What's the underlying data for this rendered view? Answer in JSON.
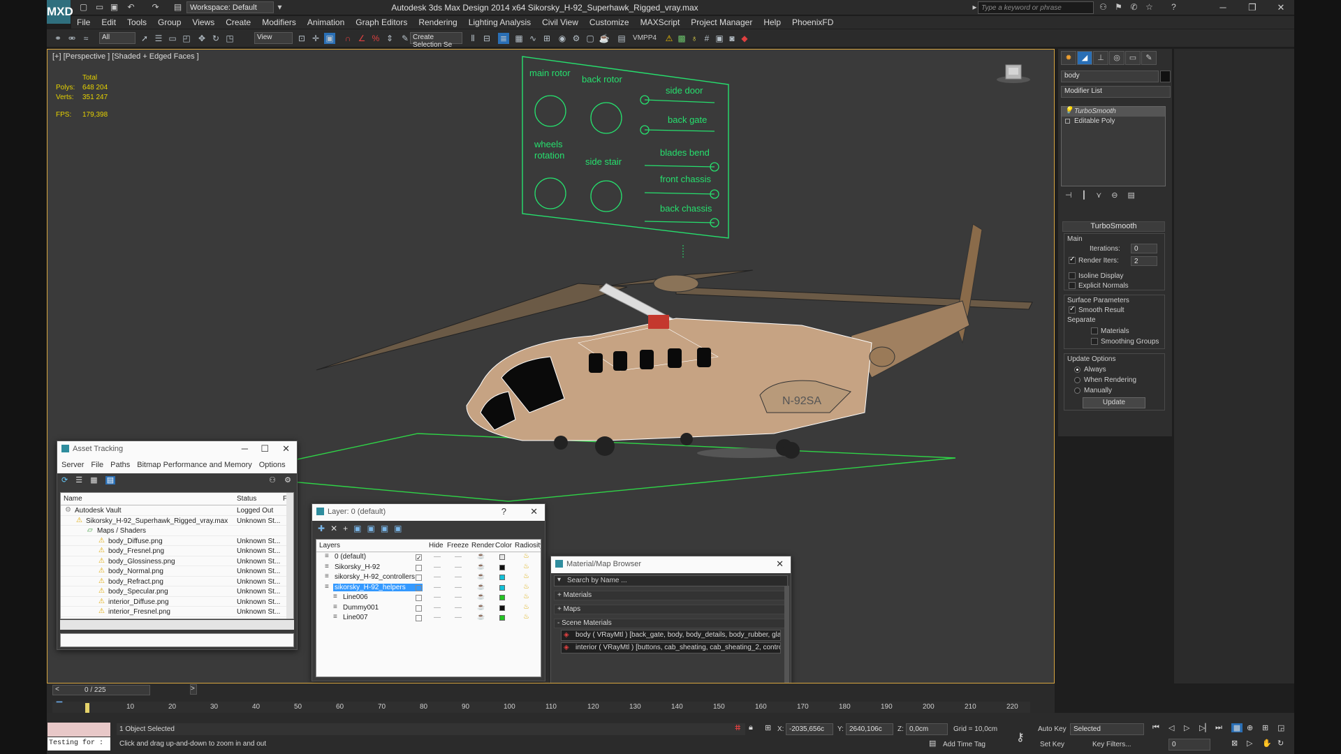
{
  "app": {
    "title": "Autodesk 3ds Max Design 2014 x64    Sikorsky_H-92_Superhawk_Rigged_vray.max",
    "logo": "MXD",
    "workspace": "Workspace: Default",
    "search_placeholder": "Type a keyword or phrase"
  },
  "menu": [
    "File",
    "Edit",
    "Tools",
    "Group",
    "Views",
    "Create",
    "Modifiers",
    "Animation",
    "Graph Editors",
    "Rendering",
    "Lighting Analysis",
    "Civil View",
    "Customize",
    "MAXScript",
    "Project Manager",
    "Help",
    "PhoenixFD"
  ],
  "toolbar": {
    "selection_filter": "All",
    "ref_coord": "View",
    "named_selection": "Create Selection Se",
    "vmpp": "VMPP4"
  },
  "viewport": {
    "label": "[+] [Perspective ] [Shaded + Edged Faces ]",
    "stats": {
      "total_label": "Total",
      "polys_label": "Polys:",
      "polys": "648 204",
      "verts_label": "Verts:",
      "verts": "351 247",
      "fps_label": "FPS:",
      "fps": "179,398"
    },
    "rig_board": {
      "main_rotor": "main rotor",
      "back_rotor": "back rotor",
      "side_door": "side door",
      "back_gate": "back gate",
      "wheels_rotation_1": "wheels",
      "wheels_rotation_2": "rotation",
      "side_stair": "side stair",
      "blades_bend": "blades bend",
      "front_chassis": "front chassis",
      "back_chassis": "back chassis"
    },
    "tail_marking": "N-92SA"
  },
  "command_panel": {
    "object_name": "body",
    "modifier_list": "Modifier List",
    "stack": [
      "TurboSmooth",
      "Editable Poly"
    ],
    "rollout_title": "TurboSmooth",
    "main_group": "Main",
    "iterations_label": "Iterations:",
    "iterations": "0",
    "render_iters_label": "Render Iters:",
    "render_iters": "2",
    "isoline": "Isoline Display",
    "explicit_normals": "Explicit Normals",
    "surface_params": "Surface Parameters",
    "smooth_result": "Smooth Result",
    "separate": "Separate",
    "materials": "Materials",
    "smoothing_groups": "Smoothing Groups",
    "update_options": "Update Options",
    "always": "Always",
    "when_rendering": "When Rendering",
    "manually": "Manually",
    "update_btn": "Update"
  },
  "asset_tracking": {
    "title": "Asset Tracking",
    "menu": [
      "Server",
      "File",
      "Paths",
      "Bitmap Performance and Memory",
      "Options"
    ],
    "col_name": "Name",
    "col_status": "Status",
    "col_f": "F",
    "rows": [
      {
        "name": "Autodesk Vault",
        "status": "Logged Out",
        "indent": 0
      },
      {
        "name": "Sikorsky_H-92_Superhawk_Rigged_vray.max",
        "status": "Unknown St...",
        "indent": 1
      },
      {
        "name": "Maps / Shaders",
        "status": "",
        "indent": 2
      },
      {
        "name": "body_Diffuse.png",
        "status": "Unknown St...",
        "indent": 3
      },
      {
        "name": "body_Fresnel.png",
        "status": "Unknown St...",
        "indent": 3
      },
      {
        "name": "body_Glossiness.png",
        "status": "Unknown St...",
        "indent": 3
      },
      {
        "name": "body_Normal.png",
        "status": "Unknown St...",
        "indent": 3
      },
      {
        "name": "body_Refract.png",
        "status": "Unknown St...",
        "indent": 3
      },
      {
        "name": "body_Specular.png",
        "status": "Unknown St...",
        "indent": 3
      },
      {
        "name": "interior_Diffuse.png",
        "status": "Unknown St...",
        "indent": 3
      },
      {
        "name": "interior_Fresnel.png",
        "status": "Unknown St...",
        "indent": 3
      }
    ]
  },
  "layers": {
    "title": "Layer: 0 (default)",
    "help": "?",
    "cols": [
      "Layers",
      "Hide",
      "Freeze",
      "Render",
      "Color",
      "Radiosity"
    ],
    "rows": [
      {
        "name": "0 (default)",
        "color": "#e6e6e6",
        "indent": 0,
        "selected": false,
        "check": "✓"
      },
      {
        "name": "Sikorsky_H-92",
        "color": "#111111",
        "indent": 0,
        "selected": false,
        "check": ""
      },
      {
        "name": "sikorsky_H-92_controllers",
        "color": "#11c1d8",
        "indent": 0,
        "selected": false,
        "check": ""
      },
      {
        "name": "sikorsky_H-92_helpers",
        "color": "#11c1d8",
        "indent": 0,
        "selected": true,
        "check": ""
      },
      {
        "name": "Line006",
        "color": "#22c422",
        "indent": 1,
        "selected": false,
        "check": ""
      },
      {
        "name": "Dummy001",
        "color": "#111111",
        "indent": 1,
        "selected": false,
        "check": ""
      },
      {
        "name": "Line007",
        "color": "#22c422",
        "indent": 1,
        "selected": false,
        "check": ""
      }
    ]
  },
  "material_browser": {
    "title": "Material/Map Browser",
    "search": "Search by Name ...",
    "groups": [
      "+ Materials",
      "+ Maps",
      "- Scene Materials"
    ],
    "items": [
      "body ( VRayMtl ) [back_gate, body, body_details, body_rubber, glass, left_...",
      "interior ( VRayMtl ) [buttons, cab_sheating, cab_sheating_2, controls, door_..."
    ]
  },
  "timeline": {
    "frame": "0 / 225",
    "ticks": [
      "10",
      "20",
      "30",
      "40",
      "50",
      "60",
      "70",
      "80",
      "90",
      "100",
      "110",
      "120",
      "130",
      "140",
      "150",
      "160",
      "170",
      "180",
      "190",
      "200",
      "210",
      "220"
    ]
  },
  "status": {
    "selected": "1 Object Selected",
    "prompt": "Click and drag up-and-down to zoom in and out",
    "script": "Testing for :",
    "x_label": "X:",
    "x": "-2035,656c",
    "y_label": "Y:",
    "y": "2640,106c",
    "z_label": "Z:",
    "z": "0,0cm",
    "grid": "Grid = 10,0cm",
    "add_time_tag": "Add Time Tag",
    "auto_key": "Auto Key",
    "set_key": "Set Key",
    "key_mode": "Selected",
    "key_filters": "Key Filters...",
    "frame": "0"
  },
  "colors": {
    "viewport_border": "#d7a540",
    "rig_green": "#26e06e",
    "selection_blue": "#3399ff",
    "warn": "#f2c200"
  }
}
